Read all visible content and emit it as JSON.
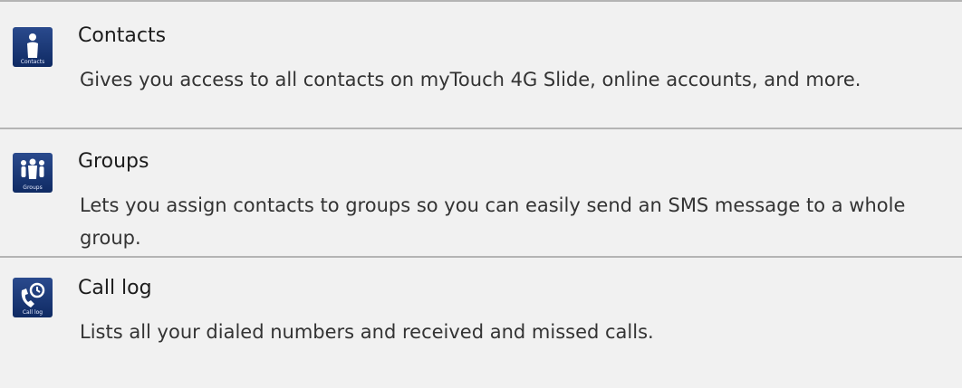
{
  "items": [
    {
      "icon": "contacts-icon",
      "icon_caption": "Contacts",
      "title": "Contacts",
      "description": "Gives you access to all contacts on myTouch 4G Slide, online accounts, and more."
    },
    {
      "icon": "groups-icon",
      "icon_caption": "Groups",
      "title": "Groups",
      "description": "Lets you assign contacts to groups so you can easily send an SMS message to a whole group."
    },
    {
      "icon": "call-log-icon",
      "icon_caption": "Call log",
      "title": "Call log",
      "description": "Lists all your dialed numbers and received and missed calls."
    }
  ],
  "colors": {
    "background": "#f1f1f1",
    "divider": "#b4b4b4",
    "icon_bg": "#1b3a7a"
  }
}
